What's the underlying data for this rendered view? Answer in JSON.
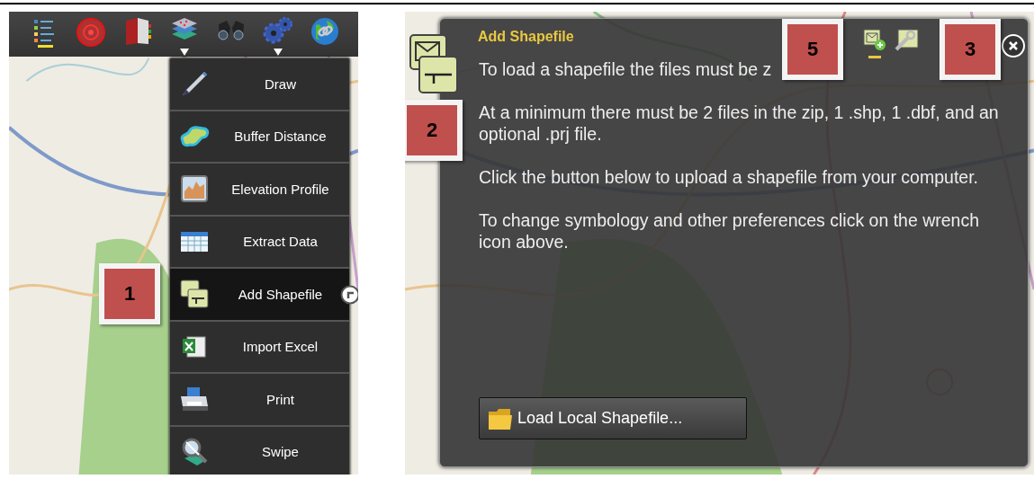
{
  "toolbar": {
    "items": [
      {
        "dropdown": false
      },
      {
        "dropdown": false
      },
      {
        "dropdown": false
      },
      {
        "dropdown": true
      },
      {
        "dropdown": false
      },
      {
        "dropdown": true
      },
      {
        "dropdown": false
      }
    ]
  },
  "menu": {
    "items": [
      {
        "label": "Draw",
        "selected": false
      },
      {
        "label": "Buffer Distance",
        "selected": false
      },
      {
        "label": "Elevation Profile",
        "selected": false
      },
      {
        "label": "Extract Data",
        "selected": false
      },
      {
        "label": "Add Shapefile",
        "selected": true
      },
      {
        "label": "Import Excel",
        "selected": false
      },
      {
        "label": "Print",
        "selected": false
      },
      {
        "label": "Swipe",
        "selected": false
      }
    ]
  },
  "widget": {
    "title": "Add Shapefile",
    "tools": [
      {
        "selected": true
      },
      {
        "selected": false
      }
    ],
    "paragraphs": [
      "To load a shapefile the files must be z",
      "At a minimum there must be 2 files in the zip, 1 .shp, 1 .dbf, and an optional .prj file.",
      "Click the button below to upload a shapefile from your computer.",
      "To change symbology and other preferences click on the wrench icon above."
    ],
    "button": "Load Local Shapefile..."
  },
  "callouts": [
    {
      "number": "1"
    },
    {
      "number": "2"
    },
    {
      "number": "5"
    },
    {
      "number": "3"
    }
  ]
}
